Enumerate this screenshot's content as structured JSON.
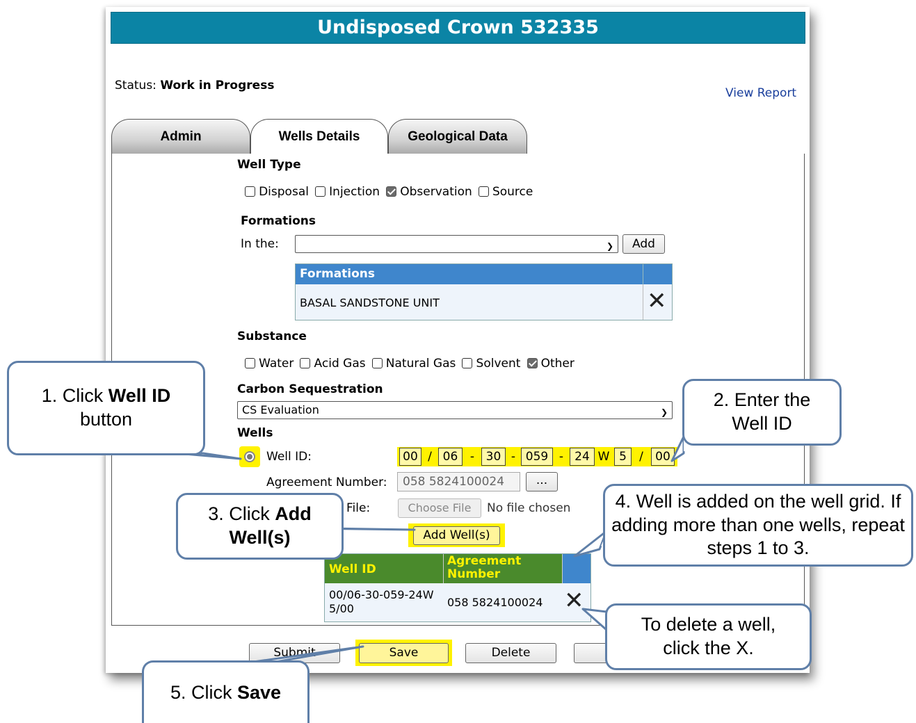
{
  "title": "Undisposed Crown 532335",
  "status": {
    "label": "Status:",
    "value": "Work in Progress"
  },
  "view_report": "View Report",
  "tabs": [
    {
      "label": "Admin"
    },
    {
      "label": "Wells Details"
    },
    {
      "label": "Geological Data"
    }
  ],
  "well_type": {
    "heading": "Well Type",
    "options": [
      {
        "label": "Disposal",
        "checked": false
      },
      {
        "label": "Injection",
        "checked": false
      },
      {
        "label": "Observation",
        "checked": true
      },
      {
        "label": "Source",
        "checked": false
      }
    ]
  },
  "formations": {
    "heading": "Formations",
    "in_the_label": "In the:",
    "select_value": "",
    "add_label": "Add",
    "grid_header": "Formations",
    "rows": [
      "BASAL SANDSTONE UNIT"
    ]
  },
  "substance": {
    "heading": "Substance",
    "options": [
      {
        "label": "Water",
        "checked": false
      },
      {
        "label": "Acid Gas",
        "checked": false
      },
      {
        "label": "Natural Gas",
        "checked": false
      },
      {
        "label": "Solvent",
        "checked": false
      },
      {
        "label": "Other",
        "checked": true
      }
    ]
  },
  "carbon_sequestration": {
    "heading": "Carbon Sequestration",
    "value": "CS Evaluation"
  },
  "wells": {
    "heading": "Wells",
    "well_id_label": "Well ID:",
    "well_id_parts": [
      "00",
      "/",
      "06",
      "-",
      "30",
      "-",
      "059",
      "-",
      "24",
      "W",
      "5",
      "/",
      "00"
    ],
    "agreement_label": "Agreement Number:",
    "agreement_value": "058 5824100024",
    "lookup_label": "...",
    "file_label": "File:",
    "choose_file": "Choose File",
    "no_file": "No file chosen",
    "add_wells_label": "Add Well(s)",
    "grid_headers": [
      "Well ID",
      "Agreement Number"
    ],
    "rows": [
      {
        "well_id": "00/06-30-059-24W5/00",
        "agreement": "058 5824100024"
      }
    ]
  },
  "actions": {
    "submit": "Submit",
    "save": "Save",
    "delete": "Delete"
  },
  "callouts": {
    "c1_a": "1. Click ",
    "c1_b": "Well ID",
    "c1_c": "button",
    "c2": "2. Enter the Well ID",
    "c3_a": "3. Click ",
    "c3_b": "Add Well(s)",
    "c4": "4. Well is added on the well grid. If adding more than one wells, repeat steps 1 to 3.",
    "c_delete": "To delete a well, click the X.",
    "c5_a": "5. Click ",
    "c5_b": "Save"
  },
  "colors": {
    "title_bar": "#0b84a5",
    "grid_header": "#3f86cc",
    "highlight": "#fff200",
    "wells_header": "#4a8a2c"
  }
}
